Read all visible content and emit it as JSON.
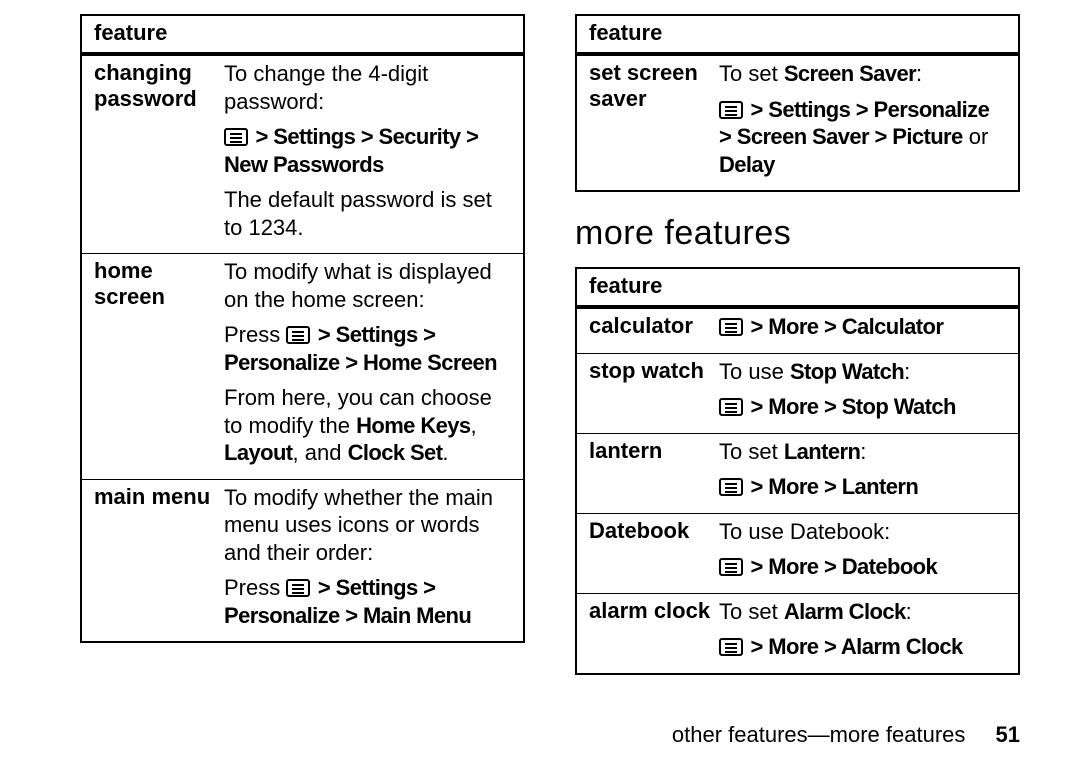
{
  "left": {
    "header": "feature",
    "rows": [
      {
        "title": "changing password",
        "p1": "To change the 4-digit password:",
        "path": " > Settings > Security > New Passwords",
        "p3": "The default password is set to 1234."
      },
      {
        "title": "home screen",
        "p1": "To modify what is displayed on the home screen:",
        "press": "Press ",
        "path": " > Settings > Personalize > Home Screen",
        "p3a": "From here, you can choose to modify the ",
        "b1": "Home Keys",
        "comma": ", ",
        "b2": "Layout",
        "and": ", and ",
        "b3": "Clock Set",
        "dot": "."
      },
      {
        "title": "main menu",
        "p1": "To modify whether the main menu uses icons or words and their order:",
        "press": "Press ",
        "path": " > Settings > Personalize > Main Menu"
      }
    ]
  },
  "rightTop": {
    "header": "feature",
    "row": {
      "title": "set screen saver",
      "p1a": "To set ",
      "b1": "Screen Saver",
      "p1c": ":",
      "path": " > Settings > Personalize > Screen Saver > Picture",
      "or": " or ",
      "delay": "Delay"
    }
  },
  "moreHeading": "more features",
  "rightBottom": {
    "header": "feature",
    "rows": [
      {
        "title": "calculator",
        "path": " > More > Calculator"
      },
      {
        "title": "stop watch",
        "p1a": "To use ",
        "b1": "Stop Watch",
        "p1c": ":",
        "path": " > More > Stop Watch"
      },
      {
        "title": "lantern",
        "p1a": "To set ",
        "b1": "Lantern",
        "p1c": ":",
        "path": " > More > Lantern"
      },
      {
        "title": "Datebook",
        "p1": "To use Datebook:",
        "path": " > More > Datebook"
      },
      {
        "title": "alarm clock",
        "p1a": "To set ",
        "b1": "Alarm Clock",
        "p1c": ":",
        "path": " > More > Alarm Clock"
      }
    ]
  },
  "footer": {
    "text": "other features—more features",
    "page": "51"
  }
}
